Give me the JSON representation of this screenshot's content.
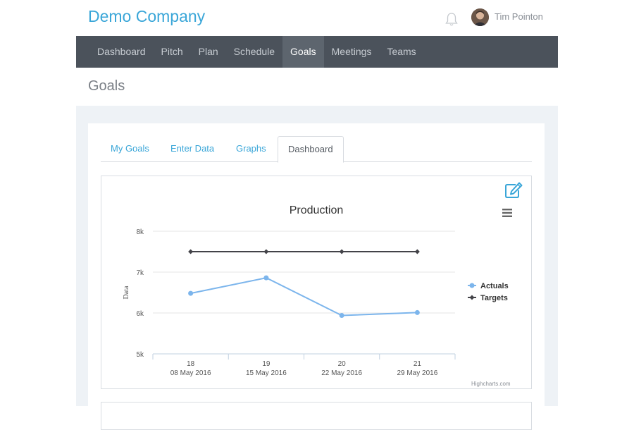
{
  "header": {
    "company": "Demo Company",
    "user_name": "Tim Pointon"
  },
  "nav": {
    "items": [
      {
        "label": "Dashboard"
      },
      {
        "label": "Pitch"
      },
      {
        "label": "Plan"
      },
      {
        "label": "Schedule"
      },
      {
        "label": "Goals",
        "active": true
      },
      {
        "label": "Meetings"
      },
      {
        "label": "Teams"
      }
    ]
  },
  "page": {
    "title": "Goals"
  },
  "tabs": [
    {
      "label": "My Goals"
    },
    {
      "label": "Enter Data"
    },
    {
      "label": "Graphs"
    },
    {
      "label": "Dashboard",
      "active": true
    }
  ],
  "colors": {
    "accent": "#3aa6d8",
    "nav_bg": "#4b525b",
    "actuals": "#7cb5ec",
    "targets": "#434348"
  },
  "chart_data": {
    "type": "line",
    "title": "Production",
    "ylabel": "Data",
    "xlabel": "",
    "ylim": [
      5000,
      8000
    ],
    "yticks": [
      "5k",
      "6k",
      "7k",
      "8k"
    ],
    "categories": [
      {
        "top": "18",
        "bottom": "08 May 2016"
      },
      {
        "top": "19",
        "bottom": "15 May 2016"
      },
      {
        "top": "20",
        "bottom": "22 May 2016"
      },
      {
        "top": "21",
        "bottom": "29 May 2016"
      }
    ],
    "series": [
      {
        "name": "Actuals",
        "values": [
          6480,
          6860,
          5940,
          6010
        ]
      },
      {
        "name": "Targets",
        "values": [
          7500,
          7500,
          7500,
          7500
        ]
      }
    ],
    "legend": "right",
    "credits": "Highcharts.com"
  }
}
